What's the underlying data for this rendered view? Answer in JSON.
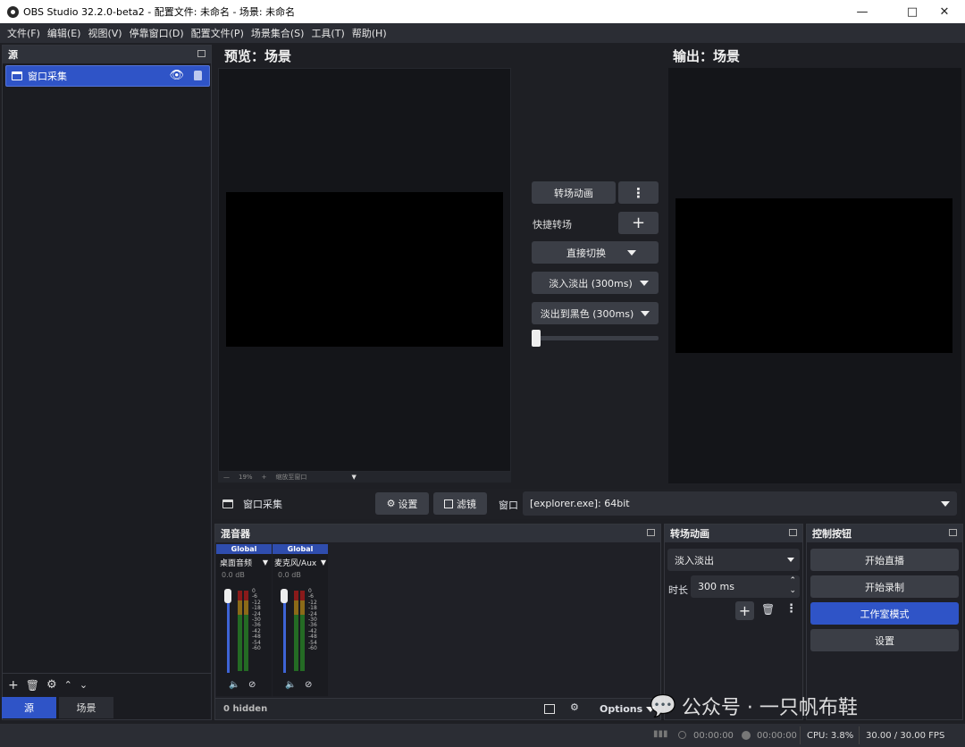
{
  "window": {
    "title": "OBS Studio 32.2.0-beta2 - 配置文件: 未命名 - 场景: 未命名"
  },
  "menu": [
    "文件(F)",
    "编辑(E)",
    "视图(V)",
    "停靠窗口(D)",
    "配置文件(P)",
    "场景集合(S)",
    "工具(T)",
    "帮助(H)"
  ],
  "sources": {
    "header": "源",
    "items": [
      {
        "label": "窗口采集",
        "visible": true,
        "locked": true
      }
    ]
  },
  "tabs": {
    "sources": "源",
    "scenes": "场景"
  },
  "preview": {
    "heading": "预览：场景",
    "zoom": "19%",
    "scale_label": "缩放至窗口"
  },
  "output": {
    "heading": "输出：场景"
  },
  "transitions_middle": {
    "transition_btn": "转场动画",
    "quick_label": "快捷转场",
    "cut_btn": "直接切换",
    "fade_btn": "淡入淡出 (300ms)",
    "fade_black_btn": "淡出到黑色 (300ms)"
  },
  "context": {
    "source_name": "窗口采集",
    "settings_btn": "设置",
    "filters_btn": "滤镜",
    "window_label": "窗口",
    "window_value": "[explorer.exe]: 64bit"
  },
  "mixer": {
    "header": "混音器",
    "channels": [
      {
        "tag": "Global",
        "name": "桌面音频",
        "db": "0.0 dB"
      },
      {
        "tag": "Global",
        "name": "麦克风/Aux",
        "db": "0.0 dB"
      }
    ],
    "ticks": [
      "0",
      "-6",
      "-12",
      "-18",
      "-24",
      "-30",
      "-36",
      "-42",
      "-48",
      "-54",
      "-60"
    ],
    "hidden": "0 hidden",
    "options": "Options"
  },
  "transitions_panel": {
    "header": "转场动画",
    "selected": "淡入淡出",
    "duration_label": "时长",
    "duration_value": "300 ms"
  },
  "controls": {
    "header": "控制按钮",
    "start_stream": "开始直播",
    "start_record": "开始录制",
    "studio_mode": "工作室模式",
    "settings": "设置"
  },
  "status": {
    "stream_time": "00:00:00",
    "record_time": "00:00:00",
    "cpu": "CPU: 3.8%",
    "fps": "30.00 / 30.00 FPS"
  },
  "watermark": "公众号 · 一只帆布鞋",
  "colors": {
    "accent": "#2f54c7",
    "panel": "#1f2026",
    "background": "#1e1f24"
  }
}
